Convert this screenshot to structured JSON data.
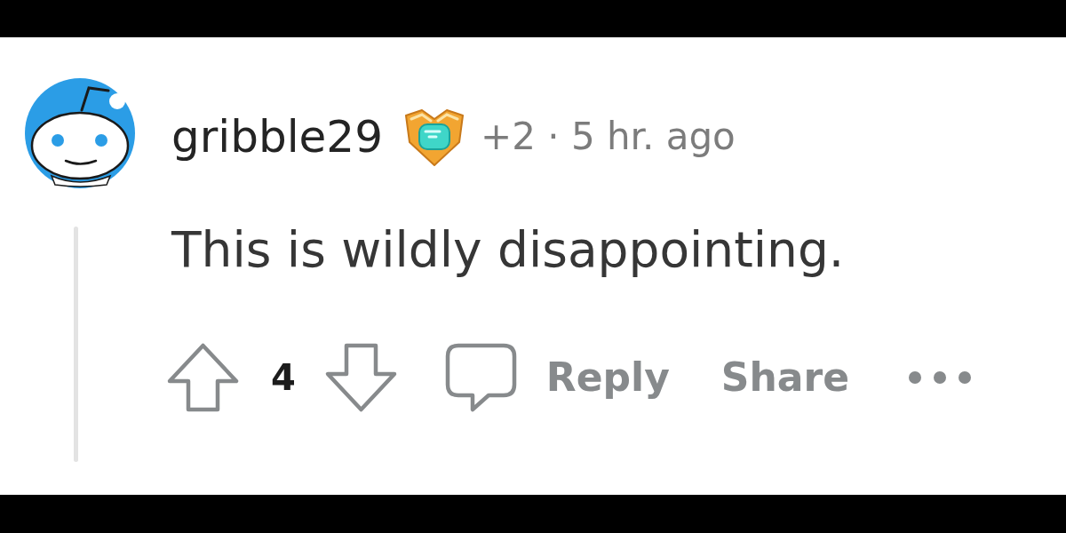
{
  "comment": {
    "author": "gribble29",
    "meta": "+2 · 5 hr. ago",
    "body": "This is wildly disappointing.",
    "votes": "4",
    "actions": [
      {
        "kind": "reply",
        "label": "Reply"
      },
      {
        "kind": "share",
        "label": "Share"
      }
    ]
  }
}
